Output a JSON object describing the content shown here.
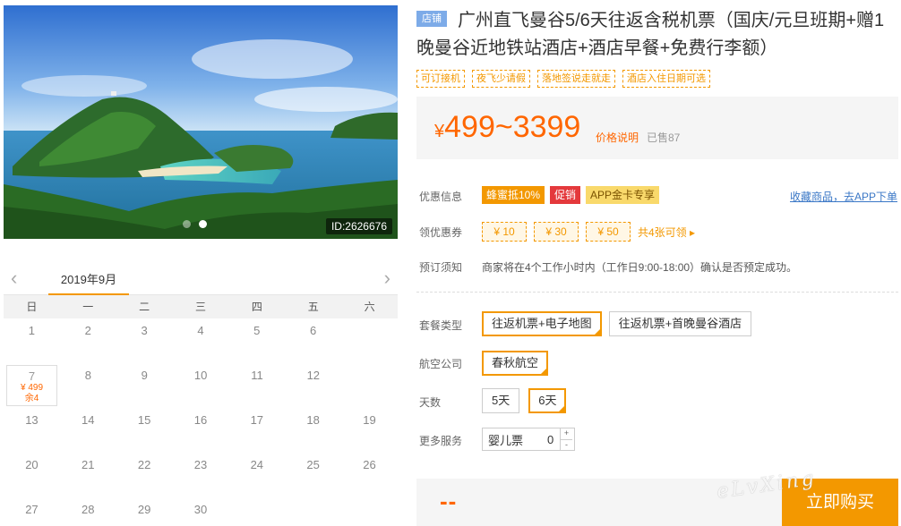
{
  "gallery": {
    "image_id": "ID:2626676",
    "slide_count": 2,
    "active_slide": 2
  },
  "calendar": {
    "month": "2019年9月",
    "prev_icon": "chevron-left-icon",
    "next_icon": "chevron-right-icon",
    "weekdays": [
      "日",
      "一",
      "二",
      "三",
      "四",
      "五",
      "六"
    ],
    "days": [
      {
        "day": "1"
      },
      {
        "day": "2"
      },
      {
        "day": "3"
      },
      {
        "day": "4"
      },
      {
        "day": "5"
      },
      {
        "day": "6"
      },
      {
        "day": "7",
        "price": "¥ 499",
        "stock": "余4"
      },
      {
        "day": "8"
      },
      {
        "day": "9"
      },
      {
        "day": "10"
      },
      {
        "day": "11"
      },
      {
        "day": "12"
      },
      {
        "day": "13"
      },
      {
        "day": "14"
      },
      {
        "day": "15"
      },
      {
        "day": "16"
      },
      {
        "day": "17"
      },
      {
        "day": "18"
      },
      {
        "day": "19"
      },
      {
        "day": "20"
      },
      {
        "day": "21"
      },
      {
        "day": "22"
      },
      {
        "day": "23"
      },
      {
        "day": "24"
      },
      {
        "day": "25"
      },
      {
        "day": "26"
      },
      {
        "day": "27"
      },
      {
        "day": "28"
      },
      {
        "day": "29"
      },
      {
        "day": "30"
      }
    ]
  },
  "product": {
    "shop_badge": "店铺",
    "title": "广州直飞曼谷5/6天往返含税机票（国庆/元旦班期+赠1晚曼谷近地铁站酒店+酒店早餐+免费行李额）",
    "tags": [
      "可订接机",
      "夜飞少请假",
      "落地签说走就走",
      "酒店入住日期可选"
    ]
  },
  "price": {
    "currency": "¥",
    "range": "499~3399",
    "note": "价格说明",
    "sold": "已售87"
  },
  "promo": {
    "label": "优惠信息",
    "items": [
      "蜂蜜抵10%",
      "促销",
      "APP金卡专享"
    ],
    "fav_link": "收藏商品，去APP下单"
  },
  "coupons": {
    "label": "领优惠券",
    "items": [
      "¥ 10",
      "¥ 30",
      "¥ 50"
    ],
    "more": "共4张可领 ▸"
  },
  "notice": {
    "label": "预订须知",
    "text": "商家将在4个工作小时内（工作日9:00-18:00）确认是否预定成功。"
  },
  "options": {
    "package_label": "套餐类型",
    "packages": [
      "往返机票+电子地图",
      "往返机票+首晚曼谷酒店"
    ],
    "airline_label": "航空公司",
    "airlines": [
      "春秋航空"
    ],
    "days_label": "天数",
    "days": [
      "5天",
      "6天"
    ],
    "more_label": "更多服务",
    "more_item": "婴儿票",
    "more_qty": "0",
    "plus": "+",
    "minus": "-"
  },
  "purchase": {
    "total": "--",
    "buy_label": "立即购买",
    "watermark": "eLvXing"
  },
  "colors": {
    "accent": "#f39800",
    "price": "#ff6600",
    "link": "#3a77c6",
    "promo_red": "#e4393c"
  }
}
